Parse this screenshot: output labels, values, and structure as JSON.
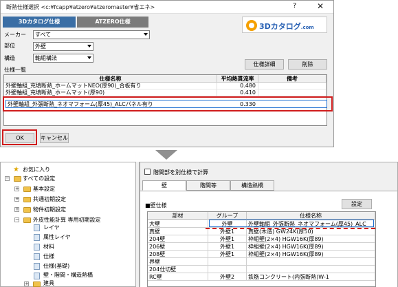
{
  "dialog": {
    "title": "断熱仕様選択 <c:¥fcapp¥atzero¥atzeromaster¥省エネ>",
    "help_glyph": "?",
    "close_glyph": "✕",
    "tabs": [
      "3Dカタログ仕様",
      "ATZERO仕様"
    ],
    "logo": {
      "text": "3Dカタログ",
      "suffix": ".com"
    },
    "fields": {
      "maker_label": "メーカー",
      "maker_value": "すべて",
      "part_label": "部位",
      "part_value": "外壁",
      "structure_label": "構造",
      "structure_value": "軸組構法"
    },
    "detail_button": "仕様詳細",
    "delete_button": "削除",
    "list_label": "仕様一覧",
    "columns": [
      "仕様名称",
      "平均熱貫流率",
      "備考"
    ],
    "rows": [
      {
        "name": "外壁軸組_充填断熱_ホームマットNEO(厚90)_合板有り",
        "value": "0.480",
        "note": ""
      },
      {
        "name": "外壁軸組_充填断熱_ホームマット(厚90)",
        "value": "0.410",
        "note": ""
      }
    ],
    "selected_row": {
      "name": "外壁軸組_外張断熱_ネオマフォーム(厚45)_ALCパネル有り",
      "value": "0.330"
    },
    "ok_button": "OK",
    "cancel_button": "キャンセル"
  },
  "tree": {
    "items": [
      {
        "label": "お気に入り",
        "kind": "star",
        "toggle": ""
      },
      {
        "label": "すべての設定",
        "kind": "folder",
        "toggle": "−"
      },
      {
        "label": "基本設定",
        "kind": "folder",
        "toggle": "+"
      },
      {
        "label": "共通初期設定",
        "kind": "folder",
        "toggle": "+"
      },
      {
        "label": "物件初期設定",
        "kind": "folder",
        "toggle": "+"
      },
      {
        "label": "外皮性能計算 専用初期設定",
        "kind": "folder",
        "toggle": "−"
      },
      {
        "label": "レイヤ",
        "kind": "doc",
        "toggle": ""
      },
      {
        "label": "属性レイヤ",
        "kind": "doc",
        "toggle": ""
      },
      {
        "label": "材料",
        "kind": "doc",
        "toggle": ""
      },
      {
        "label": "仕様",
        "kind": "doc",
        "toggle": ""
      },
      {
        "label": "仕様(基礎)",
        "kind": "doc",
        "toggle": ""
      },
      {
        "label": "壁・階間・構造熱橋",
        "kind": "doc",
        "toggle": ""
      },
      {
        "label": "建具",
        "kind": "folder",
        "toggle": "+"
      }
    ]
  },
  "right_panel": {
    "checkbox_label": "階間部を別仕様で計算",
    "tabs": [
      "壁",
      "階間等",
      "構造熱橋"
    ],
    "section_label": "■壁仕様",
    "settings_button": "設定",
    "columns": [
      "部材",
      "グループ",
      "仕様名称"
    ],
    "rows": [
      {
        "part": "大壁",
        "group": "外壁",
        "spec": "外壁軸組_外張断熱_ネオマフォーム(厚45)_ALC"
      },
      {
        "part": "真壁",
        "group": "外壁1",
        "spec": "真壁(木造) GW24K(厚50)"
      },
      {
        "part": "204壁",
        "group": "外壁1",
        "spec": "枠組壁(2×4) HGW16K(厚89)"
      },
      {
        "part": "206壁",
        "group": "外壁1",
        "spec": "枠組壁(2×4) HGW16K(厚89)"
      },
      {
        "part": "208壁",
        "group": "外壁1",
        "spec": "枠組壁(2×4) HGW16K(厚89)"
      },
      {
        "part": "界壁",
        "group": "",
        "spec": ""
      },
      {
        "part": "204仕切壁",
        "group": "",
        "spec": ""
      },
      {
        "part": "RC壁",
        "group": "外壁2",
        "spec": "鉄筋コンクリート(内張断熱)W-1"
      }
    ]
  }
}
